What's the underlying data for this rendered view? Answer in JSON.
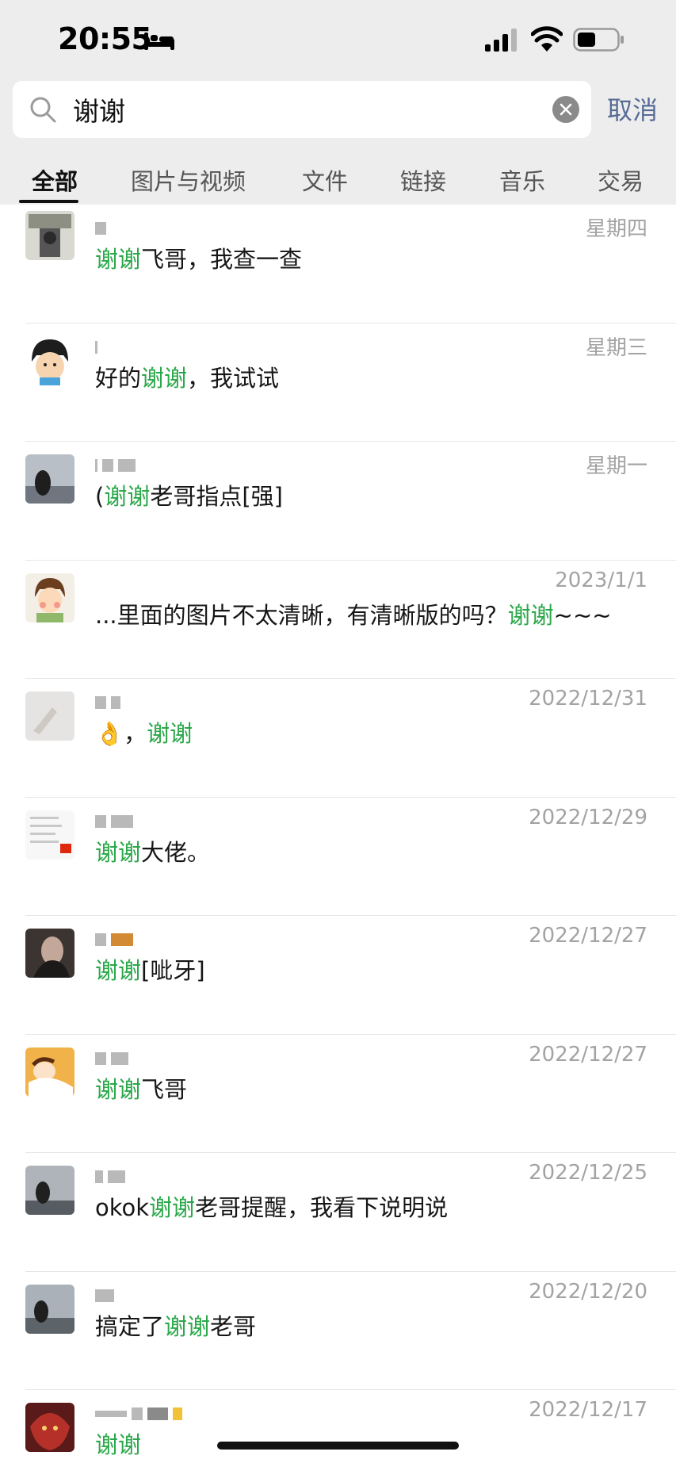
{
  "status_bar": {
    "time": "20:55"
  },
  "search": {
    "query": "谢谢",
    "cancel_label": "取消"
  },
  "tabs": [
    {
      "label": "全部",
      "active": true
    },
    {
      "label": "图片与视频"
    },
    {
      "label": "文件"
    },
    {
      "label": "链接"
    },
    {
      "label": "音乐"
    },
    {
      "label": "交易"
    }
  ],
  "colors": {
    "highlight": "#2ba84a",
    "cancel": "#576b95",
    "date": "#a3a3a3"
  },
  "results": [
    {
      "date": "星期四",
      "pre": "",
      "hl": "谢谢",
      "post": "飞哥，我查一查"
    },
    {
      "date": "星期三",
      "pre": "好的",
      "hl": "谢谢",
      "post": "，我试试"
    },
    {
      "date": "星期一",
      "pre": "(",
      "hl": "谢谢",
      "post": "老哥指点[强]"
    },
    {
      "date": "2023/1/1",
      "pre": "...里面的图片不太清晰，有清晰版的吗？",
      "hl": "谢谢",
      "post": "~~~"
    },
    {
      "date": "2022/12/31",
      "pre": "👌，",
      "hl": "谢谢",
      "post": ""
    },
    {
      "date": "2022/12/29",
      "pre": "",
      "hl": "谢谢",
      "post": "大佬。"
    },
    {
      "date": "2022/12/27",
      "pre": "",
      "hl": "谢谢",
      "post": "[呲牙]"
    },
    {
      "date": "2022/12/27",
      "pre": "",
      "hl": "谢谢",
      "post": "飞哥"
    },
    {
      "date": "2022/12/25",
      "pre": "okok",
      "hl": "谢谢",
      "post": "老哥提醒，我看下说明说"
    },
    {
      "date": "2022/12/20",
      "pre": "搞定了",
      "hl": "谢谢",
      "post": "老哥"
    },
    {
      "date": "2022/12/17",
      "pre": "",
      "hl": "谢谢",
      "post": ""
    }
  ]
}
